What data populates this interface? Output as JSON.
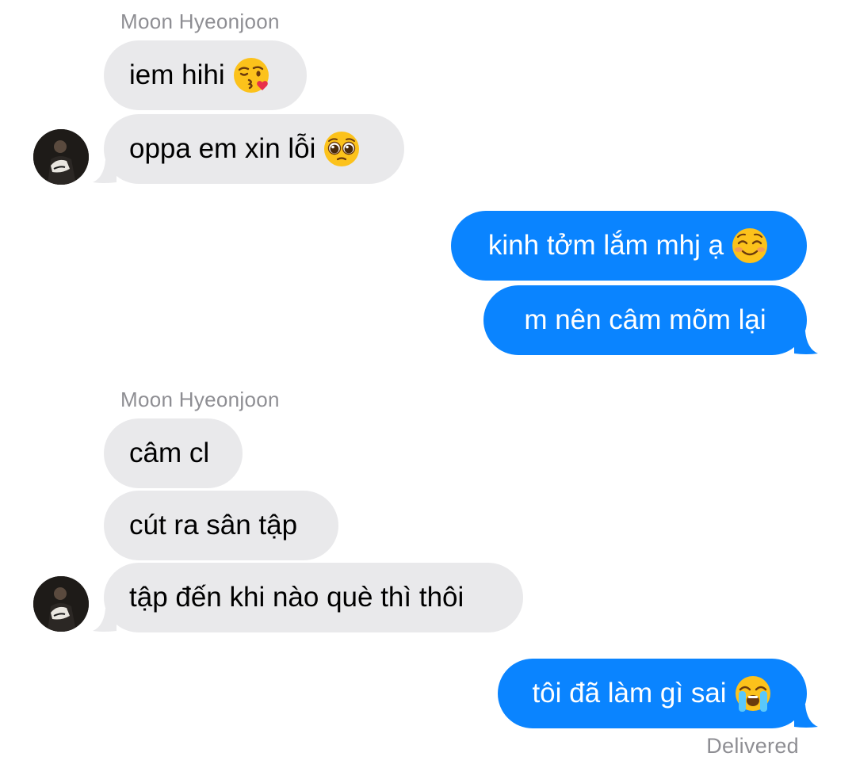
{
  "colors": {
    "incoming_bubble": "#e9e9eb",
    "outgoing_bubble": "#0a84ff",
    "meta_text": "#8e8e93"
  },
  "thread": {
    "group1": {
      "sender": "Moon Hyeonjoon",
      "messages": [
        {
          "text": "iem hihi",
          "emoji": "face-blowing-kiss-emoji"
        },
        {
          "text": "oppa em xin lỗi",
          "emoji": "pleading-face-emoji"
        }
      ]
    },
    "group2": {
      "messages": [
        {
          "text": "kinh tởm lắm mhj ạ",
          "emoji": "smiling-face-emoji"
        },
        {
          "text": "m nên câm mõm lại"
        }
      ]
    },
    "group3": {
      "sender": "Moon Hyeonjoon",
      "messages": [
        {
          "text": "câm cl"
        },
        {
          "text": "cút ra sân tập"
        },
        {
          "text": "tập đến khi nào què thì thôi"
        }
      ]
    },
    "group4": {
      "messages": [
        {
          "text": "tôi đã làm gì sai",
          "emoji": "loudly-crying-face-emoji"
        }
      ],
      "status": "Delivered"
    }
  }
}
